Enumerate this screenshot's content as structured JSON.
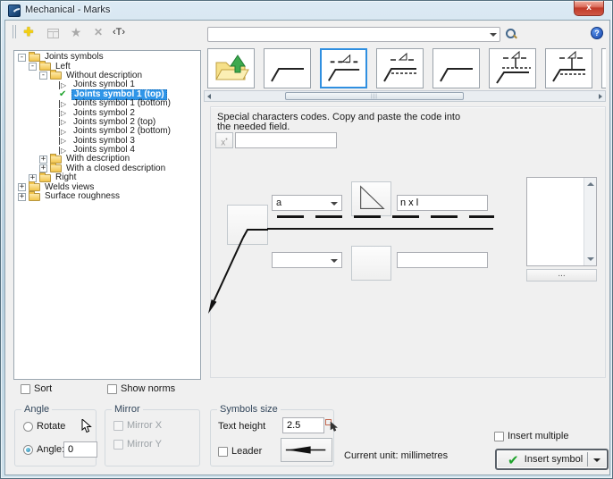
{
  "window": {
    "title": "Mechanical - Marks"
  },
  "toolbar": {
    "icons": [
      "add-icon",
      "details-icon",
      "favorite-star-icon",
      "delete-icon",
      "text-style-icon"
    ],
    "t_glyph": "‹T›",
    "search_value": "",
    "help_label": "?"
  },
  "tree": {
    "items": [
      {
        "label": "Joints symbols"
      },
      {
        "label": "Left"
      },
      {
        "label": "Without description"
      },
      {
        "label": "Joints symbol 1"
      },
      {
        "label": "Joints symbol 1 (top)"
      },
      {
        "label": "Joints symbol 1 (bottom)"
      },
      {
        "label": "Joints symbol 2"
      },
      {
        "label": "Joints symbol 2 (top)"
      },
      {
        "label": "Joints symbol 2 (bottom)"
      },
      {
        "label": "Joints symbol 3"
      },
      {
        "label": "Joints symbol 4"
      },
      {
        "label": "With description"
      },
      {
        "label": "With a closed description"
      },
      {
        "label": "Right"
      },
      {
        "label": "Welds views"
      },
      {
        "label": "Surface roughness"
      }
    ],
    "selected": "Joints symbol 1 (top)"
  },
  "thumbnails": {
    "items": [
      "open-folder",
      "leader-plain",
      "leader-dashed-above-triangle",
      "leader-triangle-dashed-below",
      "leader-plain-2",
      "leader-triangle-stem-dashed-above",
      "leader-triangle-stem-dashed-below",
      "partial"
    ],
    "selected_index": 2
  },
  "special_chars": {
    "line1": "Special characters codes. Copy and paste the code into",
    "line2": "the needed field.",
    "code_button": "x",
    "code_value": ""
  },
  "editor": {
    "top_combo_value": "a",
    "top_field_value": "n x l",
    "bottom_combo_value": "",
    "bottom_field_value": "",
    "dots_button": "..."
  },
  "options": {
    "sort": "Sort",
    "show_norms": "Show norms"
  },
  "angle_group": {
    "title": "Angle",
    "rotate": "Rotate",
    "angle_label": "Angle:",
    "angle_value": "0"
  },
  "mirror_group": {
    "title": "Mirror",
    "mirror_x": "Mirror X",
    "mirror_y": "Mirror Y"
  },
  "symbols_group": {
    "title": "Symbols size",
    "text_height_label": "Text height",
    "text_height_value": "2.5",
    "leader": "Leader"
  },
  "footer": {
    "current_unit": "Current unit: millimetres",
    "insert_multiple": "Insert multiple",
    "insert_symbol": "Insert symbol"
  },
  "colors": {
    "selection_blue": "#2f95e8",
    "check_green": "#1fa32c",
    "folder_yellow": "#f2c54d",
    "close_red": "#c03a28",
    "client_bg": "#f0f0f0"
  }
}
